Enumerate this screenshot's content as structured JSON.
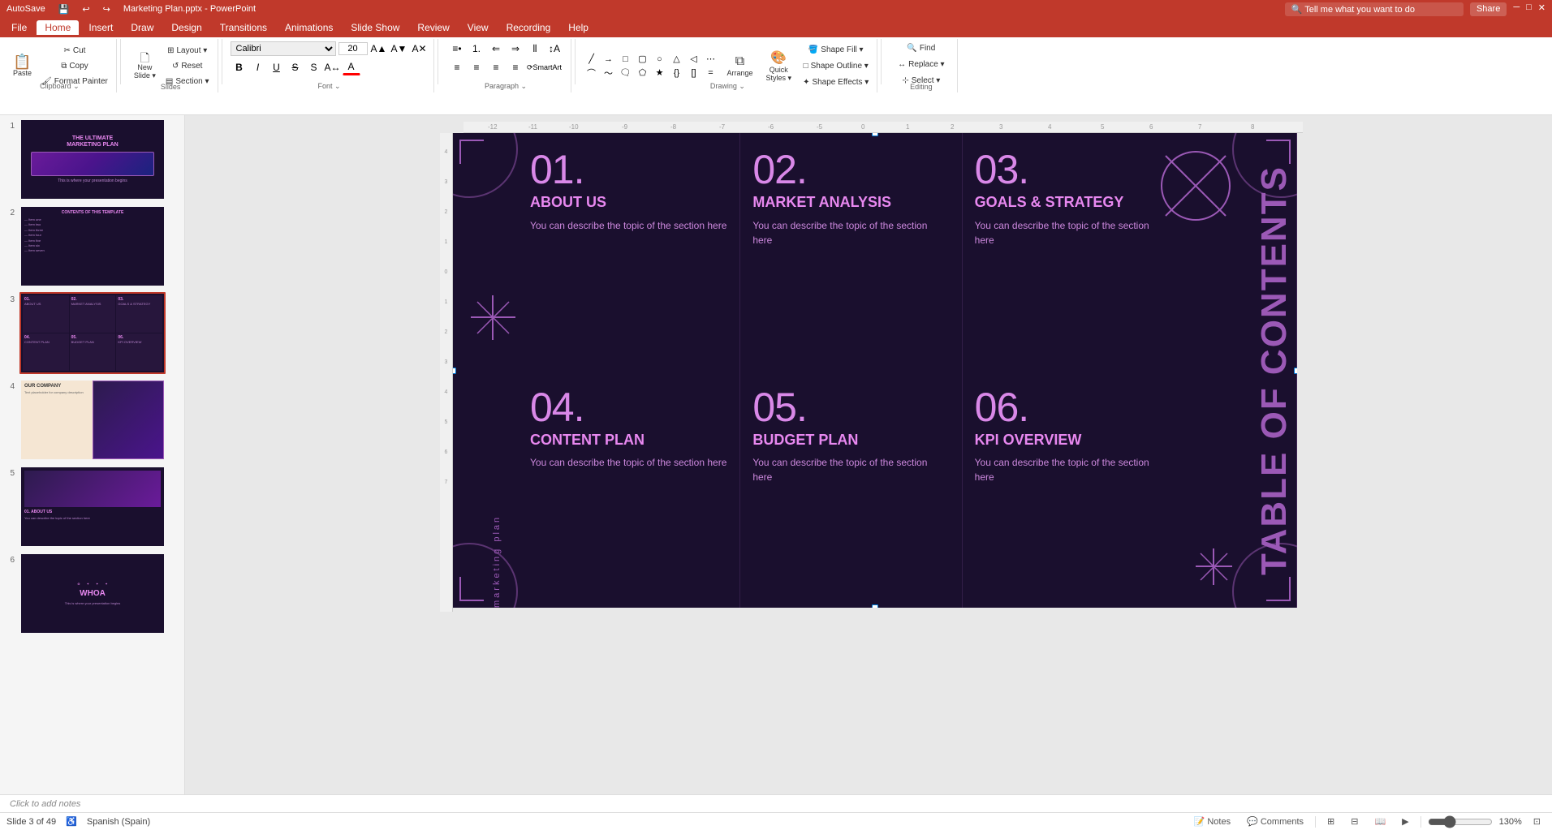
{
  "app": {
    "title": "PowerPoint",
    "file_name": "Marketing Plan.pptx"
  },
  "titlebar": {
    "left_items": [
      "AutoSave",
      "💾",
      "↩",
      "↪"
    ],
    "center": "Marketing Plan.pptx - PowerPoint",
    "right": "Share"
  },
  "menubar": {
    "items": [
      "File",
      "Home",
      "Insert",
      "Draw",
      "Design",
      "Transitions",
      "Animations",
      "Slide Show",
      "Review",
      "View",
      "Recording",
      "Help"
    ],
    "active": "Home",
    "search_placeholder": "Tell me what you want to do"
  },
  "ribbon": {
    "groups": [
      {
        "name": "Clipboard",
        "buttons": [
          "Paste",
          "Cut",
          "Copy",
          "Format Painter"
        ]
      },
      {
        "name": "Slides",
        "buttons": [
          "New Slide",
          "Layout",
          "Reset",
          "Section"
        ]
      },
      {
        "name": "Font",
        "font_name": "Calibri",
        "font_size": "20",
        "bold": false,
        "italic": false,
        "underline": false
      },
      {
        "name": "Paragraph",
        "buttons": [
          "Bullets",
          "Numbering",
          "Indent",
          "Align"
        ]
      },
      {
        "name": "Drawing",
        "buttons": [
          "Arrange",
          "Quick Styles",
          "Shape Fill",
          "Shape Outline",
          "Shape Effects"
        ]
      },
      {
        "name": "Editing",
        "buttons": [
          "Find",
          "Replace",
          "Select"
        ]
      }
    ]
  },
  "slides": [
    {
      "num": 1,
      "title": "THE ULTIMATE MARKETING PLAN",
      "bg": "dark-purple"
    },
    {
      "num": 2,
      "title": "CONTENTS OF THIS TEMPLATE",
      "bg": "dark-purple"
    },
    {
      "num": 3,
      "title": "TABLE OF CONTENTS",
      "bg": "dark-purple",
      "active": true
    },
    {
      "num": 4,
      "title": "OUR COMPANY",
      "bg": "light-tan"
    },
    {
      "num": 5,
      "title": "01. ABOUT US",
      "bg": "dark-purple"
    },
    {
      "num": 6,
      "title": "WHOA",
      "bg": "dark-purple"
    }
  ],
  "slide3": {
    "side_text": "Marketing plan",
    "vertical_title": "TABLE OF CONTENTS",
    "items": [
      {
        "num": "01.",
        "title": "ABOUT US",
        "desc": "You can describe the topic of the section here"
      },
      {
        "num": "02.",
        "title": "MARKET ANALYSIS",
        "desc": "You can describe the topic of the section here"
      },
      {
        "num": "03.",
        "title": "GOALS & STRATEGY",
        "desc": "You can describe the topic of the section here"
      },
      {
        "num": "04.",
        "title": "CONTENT PLAN",
        "desc": "You can describe the topic of the section here"
      },
      {
        "num": "05.",
        "title": "BUDGET PLAN",
        "desc": "You can describe the topic of the section here"
      },
      {
        "num": "06.",
        "title": "KPI OVERVIEW",
        "desc": "You can describe the topic of the section here"
      }
    ]
  },
  "statusbar": {
    "slide_info": "Slide 3 of 49",
    "language": "Spanish (Spain)",
    "notes_label": "Notes",
    "comments_label": "Comments",
    "zoom": "130%"
  },
  "notes": {
    "placeholder": "Click to add notes"
  }
}
